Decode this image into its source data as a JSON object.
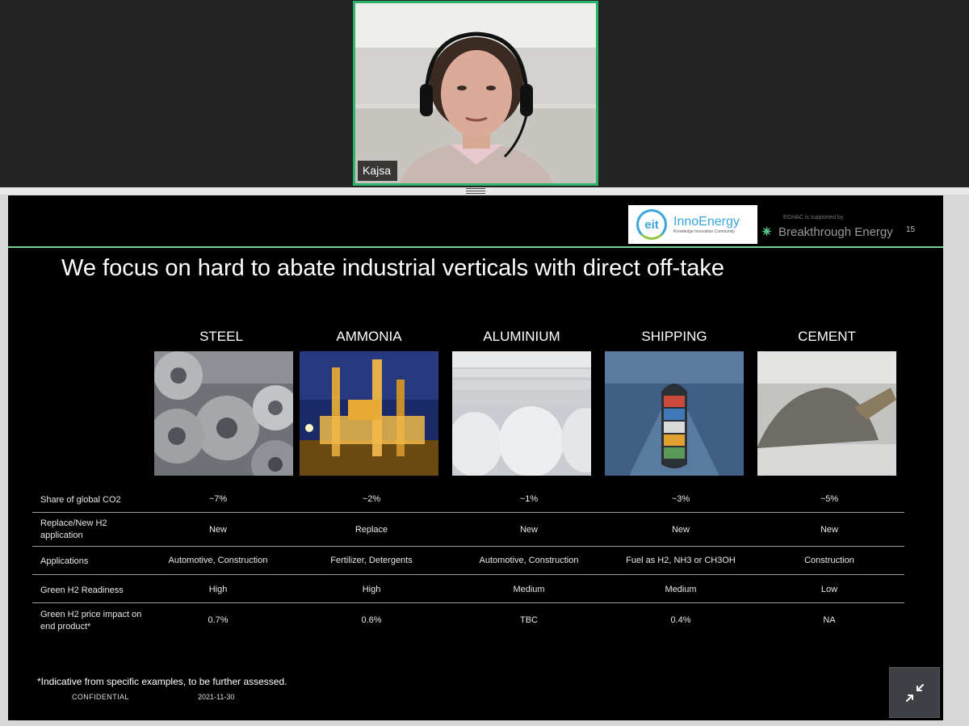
{
  "participant": {
    "name": "Kajsa"
  },
  "colors": {
    "speaker_border": "#2db36b",
    "accent_green": "#7bd08e",
    "inno_blue": "#3aa6d9"
  },
  "slide": {
    "logos": {
      "eit": "eit",
      "inno_title": "InnoEnergy",
      "inno_sub": "Knowledge Innovation Community",
      "be_small": "EGHAC is supported by",
      "be_text": "Breakthrough Energy"
    },
    "page_number": "15",
    "title": "We focus on hard to abate industrial verticals with direct off-take",
    "columns": [
      "STEEL",
      "AMMONIA",
      "ALUMINIUM",
      "SHIPPING",
      "CEMENT"
    ],
    "rows": [
      {
        "label": "Share of global CO2",
        "values": [
          "~7%",
          "~2%",
          "~1%",
          "~3%",
          "~5%"
        ]
      },
      {
        "label": "Replace/New H2 application",
        "values": [
          "New",
          "Replace",
          "New",
          "New",
          "New"
        ]
      },
      {
        "label": "Applications",
        "values": [
          "Automotive, Construction",
          "Fertilizer, Detergents",
          "Automotive, Construction",
          "Fuel as H2, NH3 or CH3OH",
          "Construction"
        ]
      },
      {
        "label": "Green H2 Readiness",
        "values": [
          "High",
          "High",
          "Medium",
          "Medium",
          "Low"
        ]
      },
      {
        "label": "Green H2 price impact on end product*",
        "values": [
          "0.7%",
          "0.6%",
          "TBC",
          "0.4%",
          "NA"
        ]
      }
    ],
    "footnote": "*Indicative from specific examples, to be further assessed.",
    "confidential": "CONFIDENTIAL",
    "date": "2021-11-30"
  },
  "controls": {
    "exit_fullscreen_icon": "collapse-arrows-icon"
  }
}
